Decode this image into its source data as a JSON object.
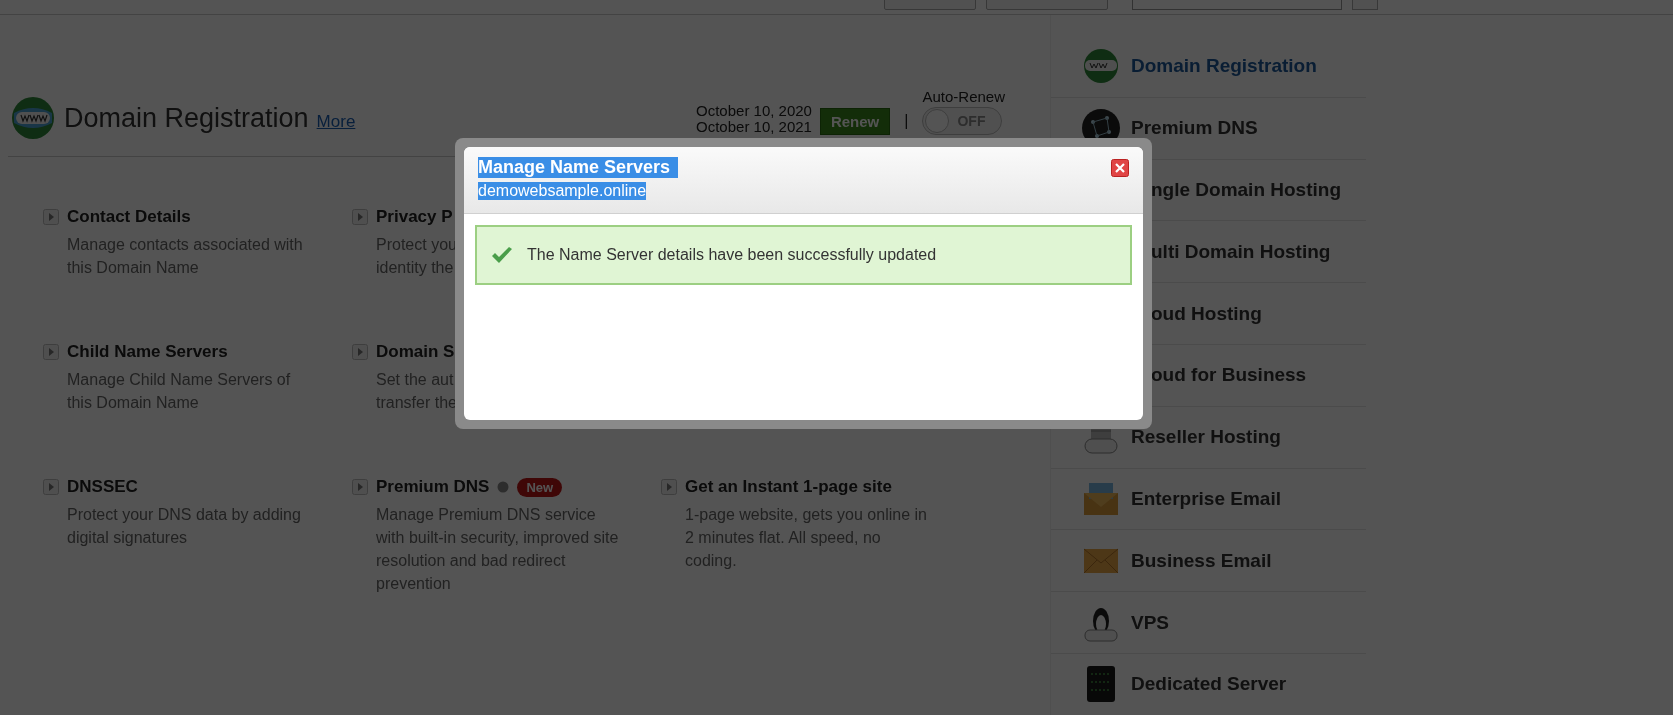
{
  "domain": {
    "title": "Domain Registration",
    "more_link": "More",
    "dates": [
      "October 10, 2020",
      "October 10, 2021"
    ],
    "renew_button": "Renew",
    "separator": "|",
    "auto_renew": {
      "label": "Auto-Renew",
      "state_text": "OFF",
      "on": false
    }
  },
  "feature_rows": [
    [
      {
        "title": "Contact Details",
        "description_lines": [
          "Manage contacts associated with",
          "this Domain Name"
        ]
      },
      {
        "title": "Privacy P",
        "description_lines": [
          "Protect you",
          "identity the"
        ]
      }
    ],
    [
      {
        "title": "Child Name Servers",
        "description_lines": [
          "Manage Child Name Servers of",
          "this Domain Name"
        ]
      },
      {
        "title": "Domain S",
        "description_lines": [
          "Set the aut",
          "transfer the"
        ]
      }
    ],
    [
      {
        "title": "DNSSEC",
        "description_lines": [
          "Protect your DNS data by adding",
          "digital signatures"
        ]
      },
      {
        "title": "Premium DNS",
        "badge": "New",
        "description_lines": [
          "Manage Premium DNS service",
          "with built-in security, improved site",
          "resolution and bad redirect",
          "prevention"
        ]
      },
      {
        "title": "Get an Instant 1-page site",
        "description_lines": [
          "1-page website, gets you online in",
          "2 minutes flat. All speed, no",
          "coding."
        ]
      }
    ]
  ],
  "sidebar": {
    "items": [
      {
        "label": "Domain Registration",
        "kind": "globe",
        "selected": true
      },
      {
        "label": "Premium DNS",
        "kind": "network",
        "selected": false
      },
      {
        "label": "ngle Domain Hosting",
        "kind": "covered",
        "selected": false
      },
      {
        "label": "ulti Domain Hosting",
        "kind": "covered",
        "selected": false
      },
      {
        "label": "oud Hosting",
        "kind": "covered",
        "selected": false
      },
      {
        "label": "oud for Business",
        "kind": "covered",
        "selected": false
      },
      {
        "label": "Reseller Hosting",
        "kind": "reseller",
        "selected": false
      },
      {
        "label": "Enterprise Email",
        "kind": "enterprise-mail",
        "selected": false
      },
      {
        "label": "Business Email",
        "kind": "mail",
        "selected": false
      },
      {
        "label": "VPS",
        "kind": "vps",
        "selected": false
      },
      {
        "label": "Dedicated Server",
        "kind": "server",
        "selected": false
      }
    ]
  },
  "modal": {
    "title": "Manage Name Servers",
    "subtitle": "demowebsample.online",
    "message": "The Name Server details have been successfully updated"
  }
}
